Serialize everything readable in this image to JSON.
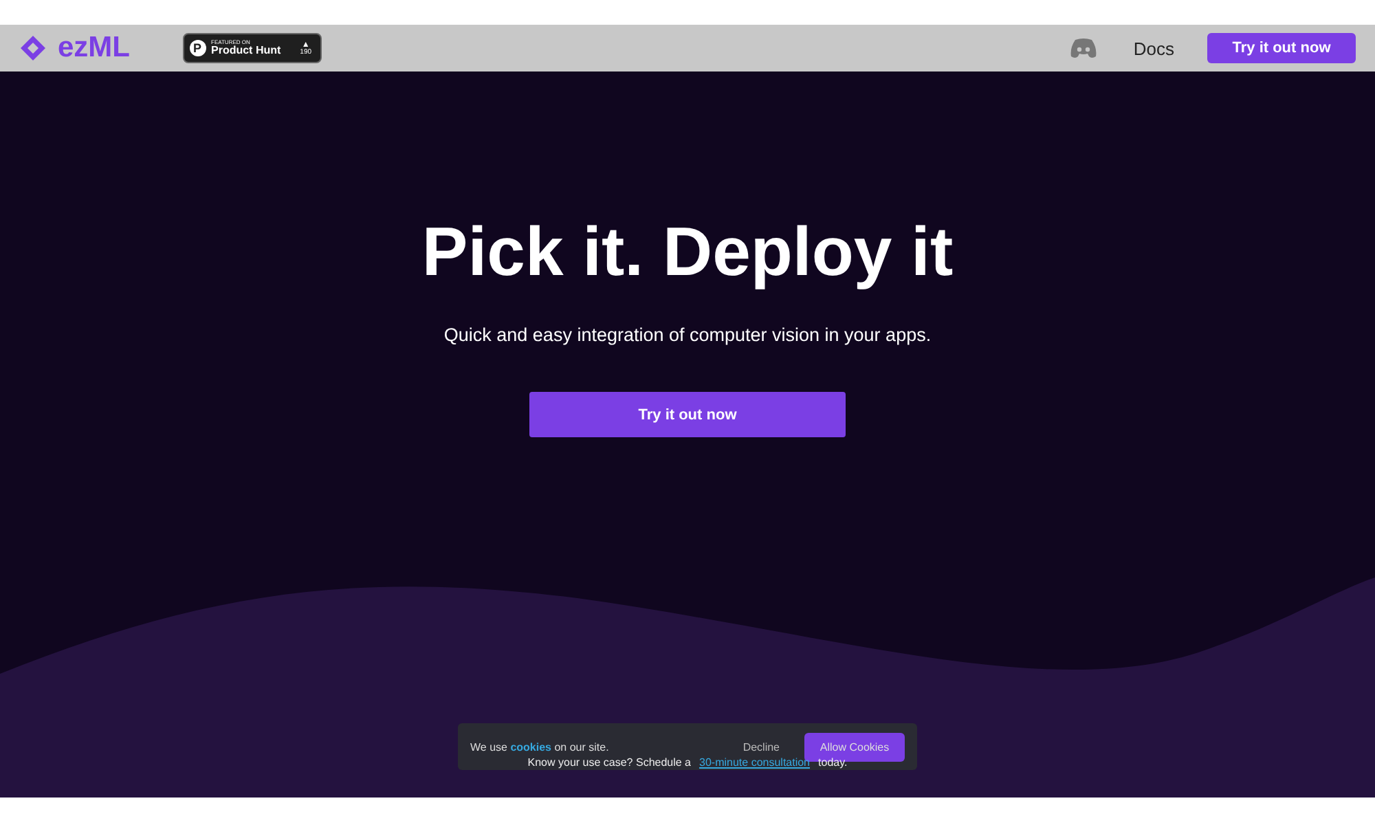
{
  "nav": {
    "logo": "ezML",
    "badge": {
      "letter": "P",
      "caption": "FEATURED ON",
      "name": "Product Hunt",
      "arrow": "▲",
      "votes": "190"
    },
    "links": [
      "Docs"
    ],
    "cta": "Try it out now"
  },
  "hero": {
    "title": "Pick it. Deploy it",
    "subtitle": "Quick and easy integration of computer vision in your apps.",
    "cta": "Try it out now"
  },
  "cookie_banner": {
    "text": "We use **cookies** on our site.",
    "decline": "Decline",
    "allow": "Allow Cookies"
  },
  "consultation": {
    "before": "Know your use case? Schedule a",
    "link": "30-minute consultation",
    "after": "today."
  }
}
